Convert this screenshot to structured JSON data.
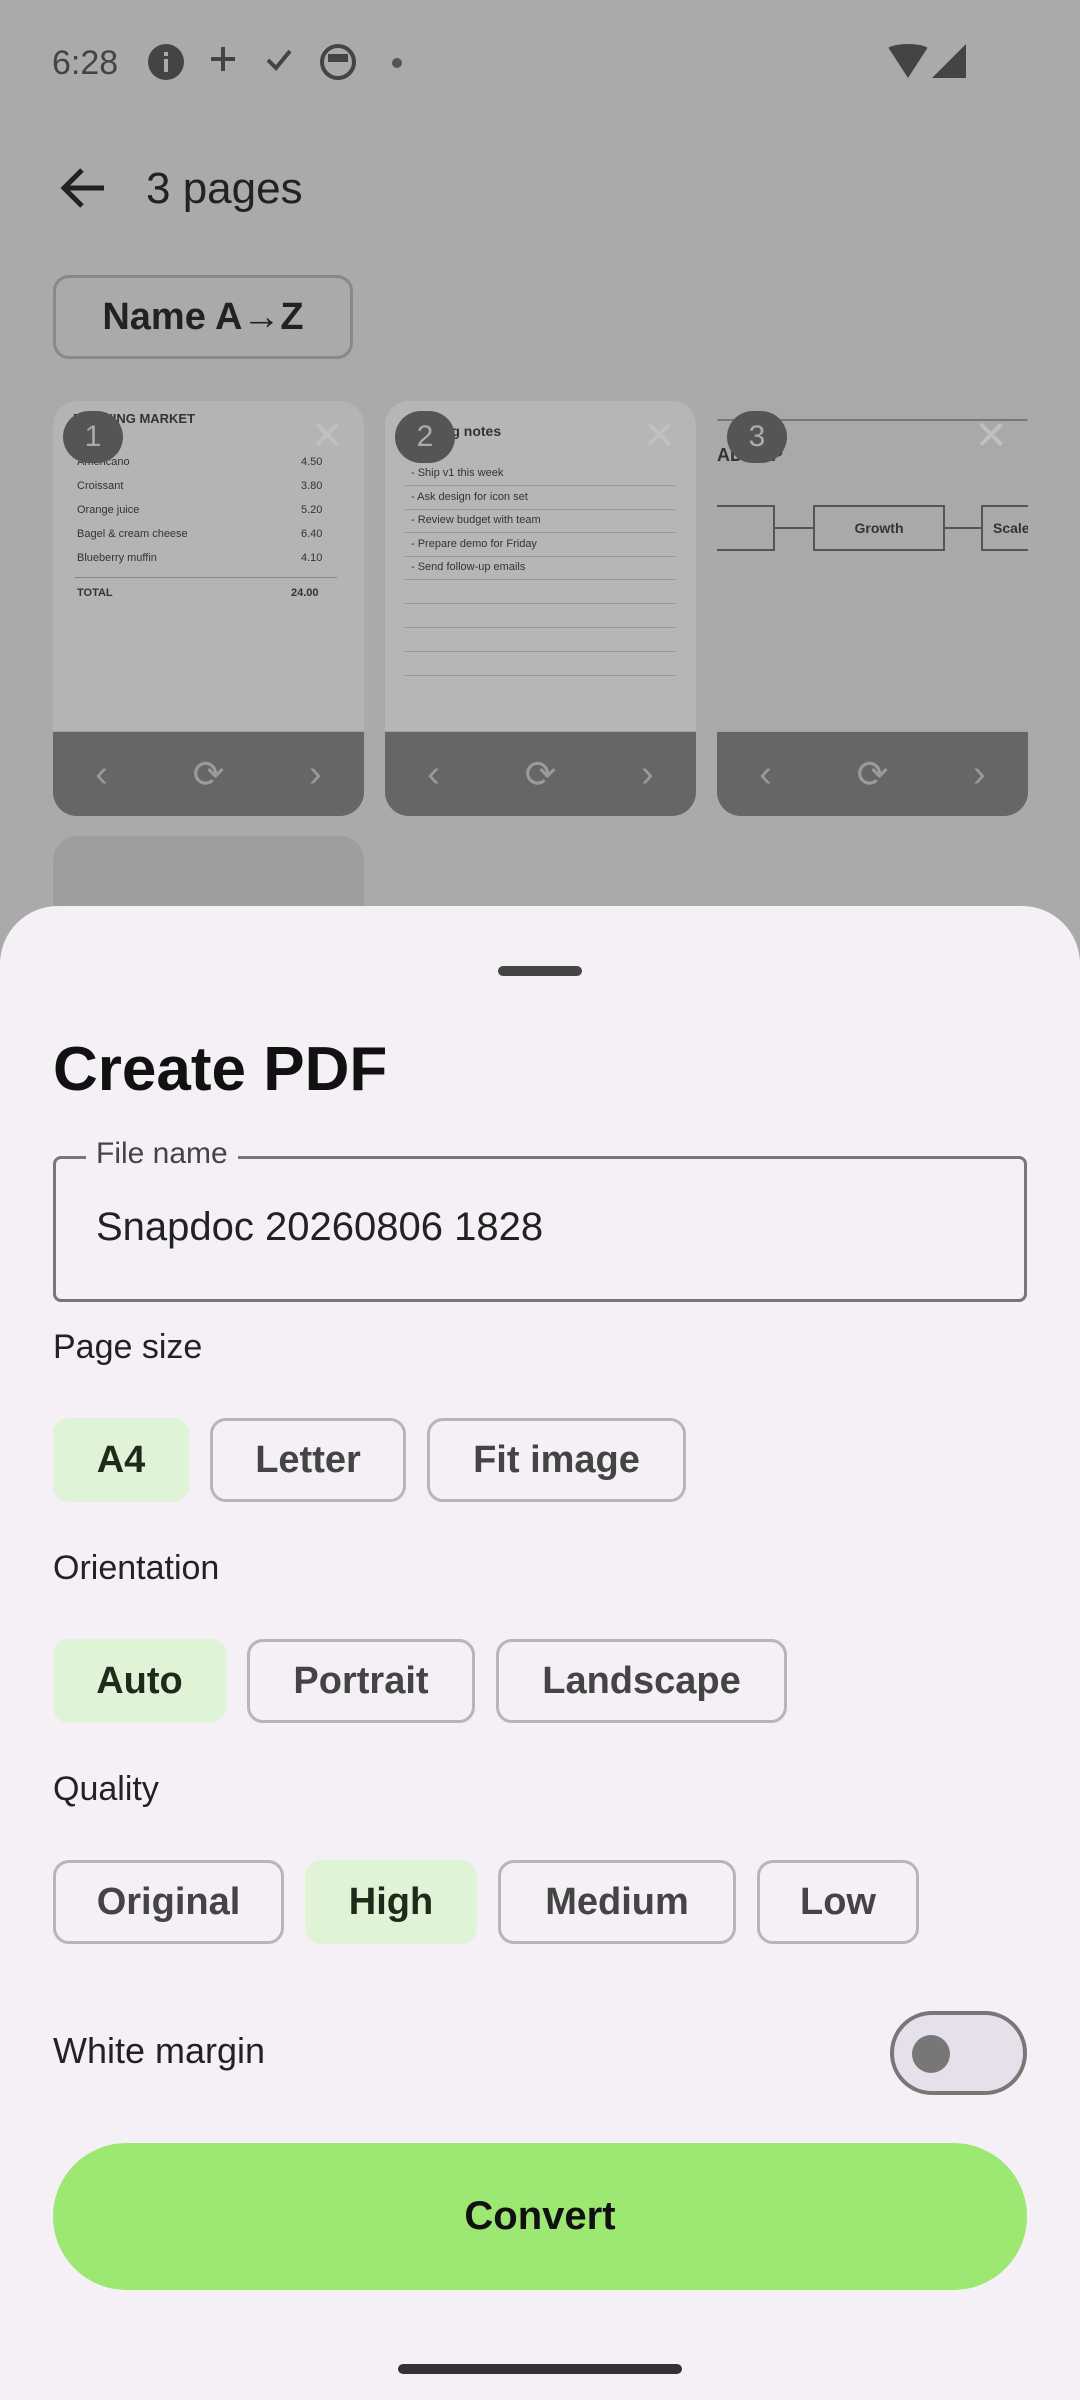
{
  "status_bar": {
    "time": "6:28"
  },
  "app_bar": {
    "title": "3 pages"
  },
  "sort": {
    "label": "Name A→Z"
  },
  "thumbnails": [
    {
      "number": "1",
      "title": "MORNING MARKET",
      "rows": [
        {
          "item": "Americano",
          "price": "4.50"
        },
        {
          "item": "Croissant",
          "price": "3.80"
        },
        {
          "item": "Orange juice",
          "price": "5.20"
        },
        {
          "item": "Bagel & cream cheese",
          "price": "6.40"
        },
        {
          "item": "Blueberry muffin",
          "price": "4.10"
        }
      ],
      "total_label": "TOTAL",
      "total_value": "24.00"
    },
    {
      "number": "2",
      "title": "Meeting notes",
      "lines": [
        "- Ship v1 this week",
        "- Ask design for icon set",
        "- Review budget with team",
        "- Prepare demo for Friday",
        "- Send follow-up emails"
      ]
    },
    {
      "number": "3",
      "title": "ADMAP",
      "boxes": [
        "Growth",
        "Scale"
      ]
    }
  ],
  "sheet": {
    "title": "Create PDF",
    "file_name_label": "File name",
    "file_name_value": "Snapdoc 20260806 1828",
    "page_size_label": "Page size",
    "page_sizes": [
      "A4",
      "Letter",
      "Fit image"
    ],
    "orientation_label": "Orientation",
    "orientations": [
      "Auto",
      "Portrait",
      "Landscape"
    ],
    "quality_label": "Quality",
    "qualities": [
      "Original",
      "High",
      "Medium",
      "Low"
    ],
    "white_margin_label": "White margin",
    "white_margin_on": false,
    "convert_label": "Convert"
  },
  "colors": {
    "selected_chip": "#dff3d6",
    "convert_button": "#9de773",
    "sheet_background": "#f4f0f6"
  }
}
